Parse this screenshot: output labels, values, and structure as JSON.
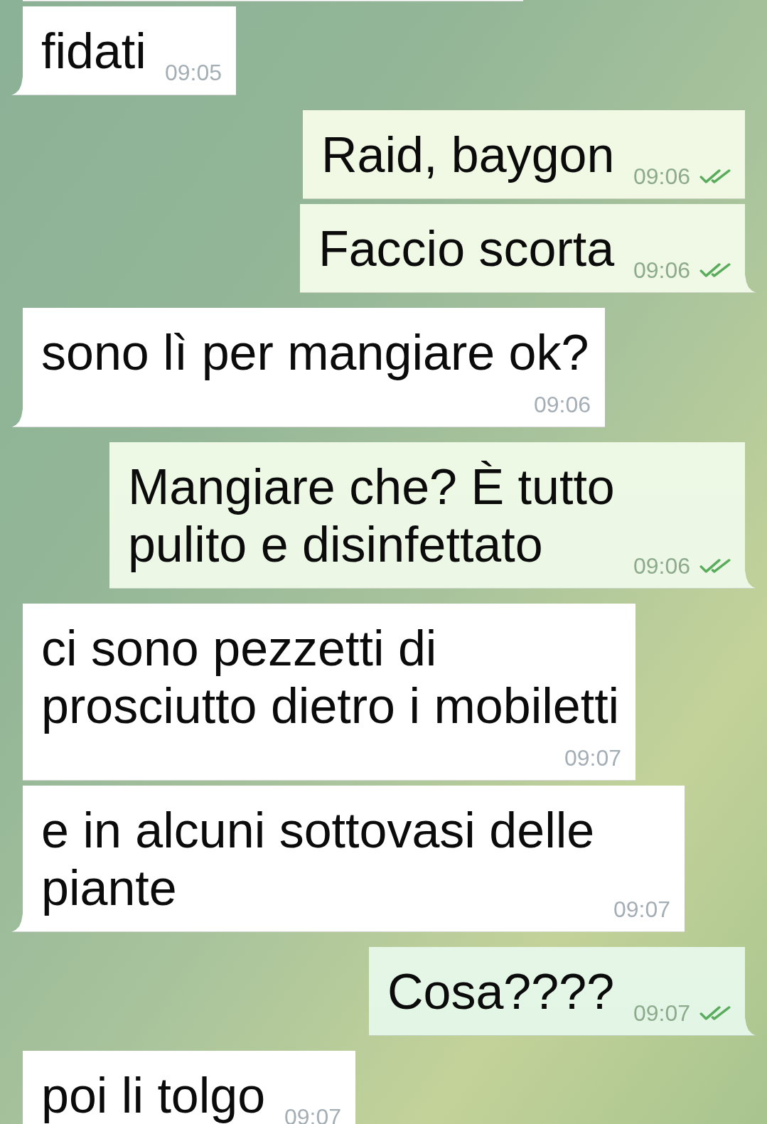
{
  "chat": {
    "messages": [
      {
        "kind": "fragment",
        "outgoing": false
      },
      {
        "kind": "message",
        "outgoing": false,
        "tail": true,
        "text": "fidati",
        "time": "09:05"
      },
      {
        "kind": "message",
        "outgoing": true,
        "tail": false,
        "text": "Raid, baygon",
        "time": "09:06",
        "read": true
      },
      {
        "kind": "message",
        "outgoing": true,
        "tail": true,
        "text": "Faccio scorta",
        "time": "09:06",
        "read": true
      },
      {
        "kind": "message",
        "outgoing": false,
        "tail": true,
        "text": "sono lì per mangiare ok?",
        "time": "09:06"
      },
      {
        "kind": "message",
        "outgoing": true,
        "tail": true,
        "text": "Mangiare che? È tutto pulito e disinfettato",
        "time": "09:06",
        "read": true
      },
      {
        "kind": "message",
        "outgoing": false,
        "tail": false,
        "text": "ci sono pezzetti di prosciutto dietro i mobiletti",
        "time": "09:07"
      },
      {
        "kind": "message",
        "outgoing": false,
        "tail": true,
        "text": "e in alcuni sottovasi delle piante",
        "time": "09:07"
      },
      {
        "kind": "message",
        "outgoing": true,
        "tail": true,
        "text": "Cosa????",
        "time": "09:07",
        "read": true
      },
      {
        "kind": "message",
        "outgoing": false,
        "tail": false,
        "text": "poi li tolgo",
        "time": "09:07"
      }
    ]
  }
}
